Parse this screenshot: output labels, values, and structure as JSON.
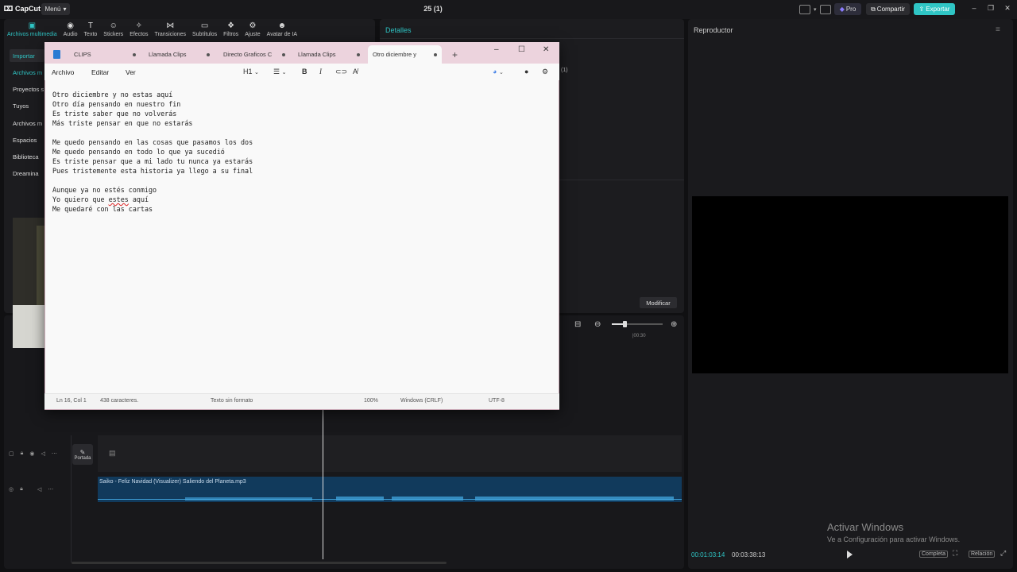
{
  "app": {
    "name": "CapCut",
    "menu_label": "Menú",
    "project_title": "25 (1)",
    "pro_label": "Pro",
    "share_label": "Compartir",
    "export_label": "Exportar"
  },
  "toolbar": {
    "tools": [
      {
        "label": "Archivos multimedia",
        "icon": "media-icon"
      },
      {
        "label": "Audio",
        "icon": "audio-icon"
      },
      {
        "label": "Texto",
        "icon": "text-icon"
      },
      {
        "label": "Stickers",
        "icon": "sticker-icon"
      },
      {
        "label": "Efectos",
        "icon": "effects-icon"
      },
      {
        "label": "Transiciones",
        "icon": "transitions-icon"
      },
      {
        "label": "Subtítulos",
        "icon": "subtitles-icon"
      },
      {
        "label": "Filtros",
        "icon": "filters-icon"
      },
      {
        "label": "Ajuste",
        "icon": "adjust-icon"
      },
      {
        "label": "Avatar de IA",
        "icon": "avatar-icon"
      }
    ]
  },
  "sidebar": {
    "items": [
      {
        "label": "Importar"
      },
      {
        "label": "Archivos m"
      },
      {
        "label": "Proyectos s"
      },
      {
        "label": "Tuyos"
      },
      {
        "label": "Archivos m"
      },
      {
        "label": "Espacios"
      },
      {
        "label": "Biblioteca"
      },
      {
        "label": "Dreamina"
      }
    ]
  },
  "details": {
    "title": "Detalles",
    "badge": "(1)",
    "modify_label": "Modificar"
  },
  "player": {
    "title": "Reproductor",
    "current_time": "00:01:03:14",
    "total_time": "00:03:38:13",
    "complete_label": "Completa",
    "ratio_label": "Relación"
  },
  "timeline": {
    "tc_mark": "|00:30",
    "cover_label": "Portada",
    "audio_clip": "Saiko - Feliz Navidad (Visualizer)  Saliendo del Planeta.mp3"
  },
  "windows_activation": {
    "title": "Activar Windows",
    "subtitle": "Ve a Configuración para activar Windows."
  },
  "notepad": {
    "tabs": [
      {
        "label": "CLIPS"
      },
      {
        "label": "Llamada Clips"
      },
      {
        "label": "Directo Graficos C"
      },
      {
        "label": "Llamada Clips"
      },
      {
        "label": "Otro diciembre y"
      }
    ],
    "menus": [
      "Archivo",
      "Editar",
      "Ver"
    ],
    "heading_select": "H1",
    "lines_before": "Otro diciembre y no estas aquí\nOtro día pensando en nuestro fin\nEs triste saber que no volverás\nMás triste pensar en que no estarás\n\nMe quedo pensando en las cosas que pasamos los dos\nMe quedo pensando en todo lo que ya sucedió\nEs triste pensar que a mi lado tu nunca ya estarás\nPues tristemente esta historia ya llego a su final\n\nAunque ya no estés conmigo\nYo quiero que ",
    "misspelled": "estes",
    "lines_after": " aquí\nMe quedaré con las cartas",
    "status": {
      "position": "Ln 16, Col 1",
      "chars": "438 caracteres.",
      "format": "Texto sin formato",
      "zoom": "100%",
      "eol": "Windows (CRLF)",
      "encoding": "UTF-8"
    }
  }
}
